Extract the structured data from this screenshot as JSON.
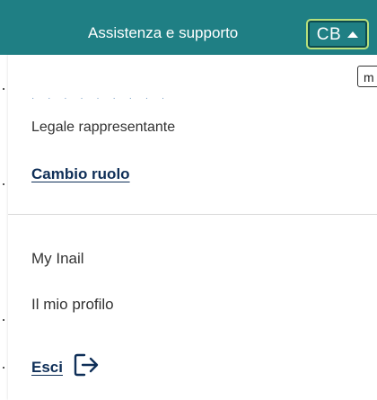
{
  "header": {
    "support_label": "Assistenza e supporto",
    "user_initials": "CB",
    "bar_color": "#1f7f84",
    "button_border_color": "#b8e07c"
  },
  "tooltip": {
    "text": "m"
  },
  "account": {
    "name": "· · · · · · · · ·",
    "role": "Legale rappresentante",
    "change_role_label": "Cambio ruolo"
  },
  "menu": {
    "items": [
      {
        "label": "My Inail"
      },
      {
        "label": "Il mio profilo"
      }
    ],
    "logout_label": "Esci"
  },
  "icons": {
    "user_menu_toggle": "caret-up-icon",
    "logout": "logout-icon"
  },
  "colors": {
    "link": "#0f2f58",
    "text": "#333333"
  }
}
